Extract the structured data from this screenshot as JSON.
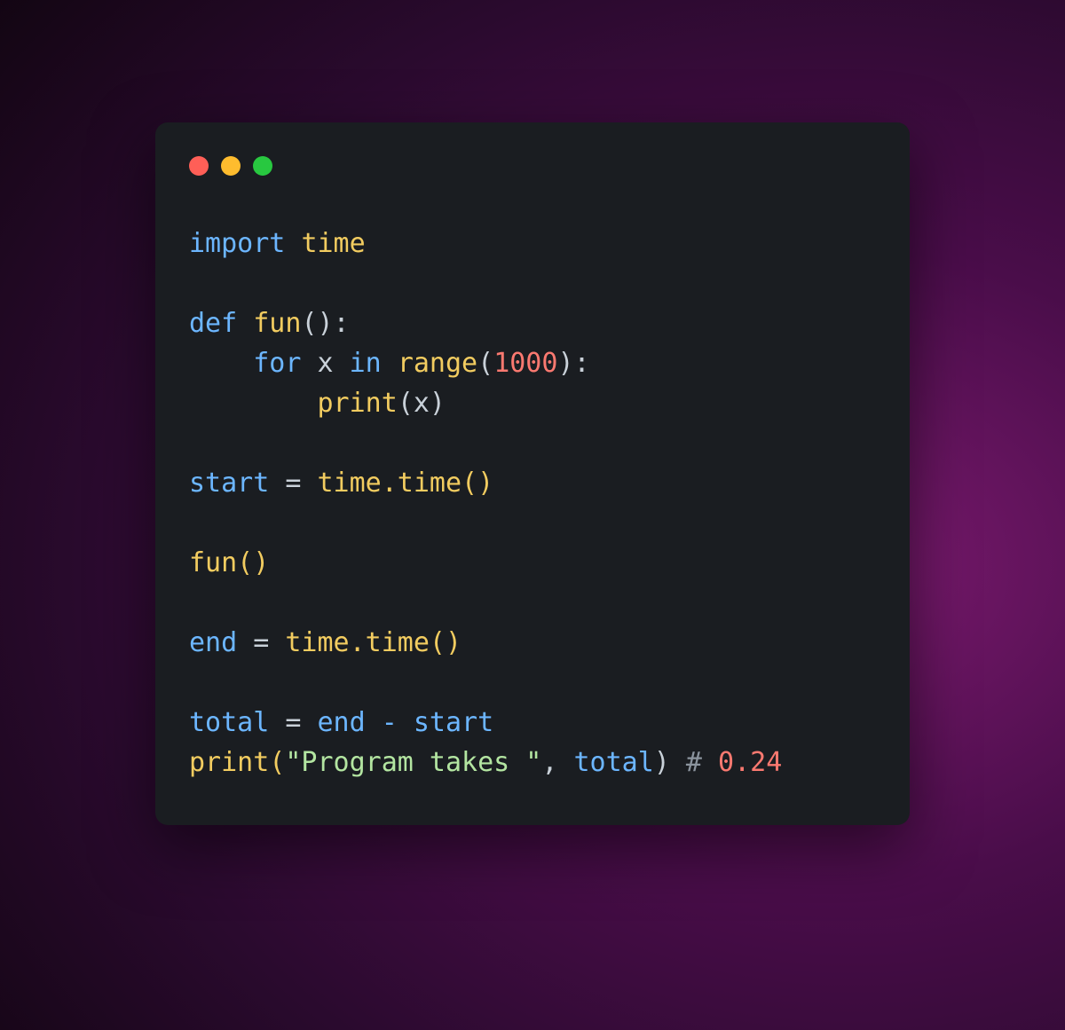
{
  "window": {
    "dots": [
      "red",
      "yellow",
      "green"
    ]
  },
  "code": {
    "kw_import": "import",
    "mod_time": "time",
    "kw_def": "def",
    "fn_fun": "fun",
    "paren_colon": "():",
    "kw_for": "for",
    "var_x": "x",
    "kw_in": "in",
    "fn_range": "range",
    "lparen": "(",
    "num_1000": "1000",
    "rparen_colon": "):",
    "fn_print": "print",
    "print_x": "(x)",
    "var_start": "start",
    "eq": " = ",
    "time_time_call": "time.time()",
    "fun_call": "fun()",
    "var_end": "end",
    "var_total": "total",
    "end_minus_start": "end - start",
    "print_open": "print(",
    "str_program_takes": "\"Program takes \"",
    "comma_sp": ", ",
    "total_ref": "total",
    "rparen_sp": ") ",
    "hash": "# ",
    "num_024": "0.24"
  }
}
